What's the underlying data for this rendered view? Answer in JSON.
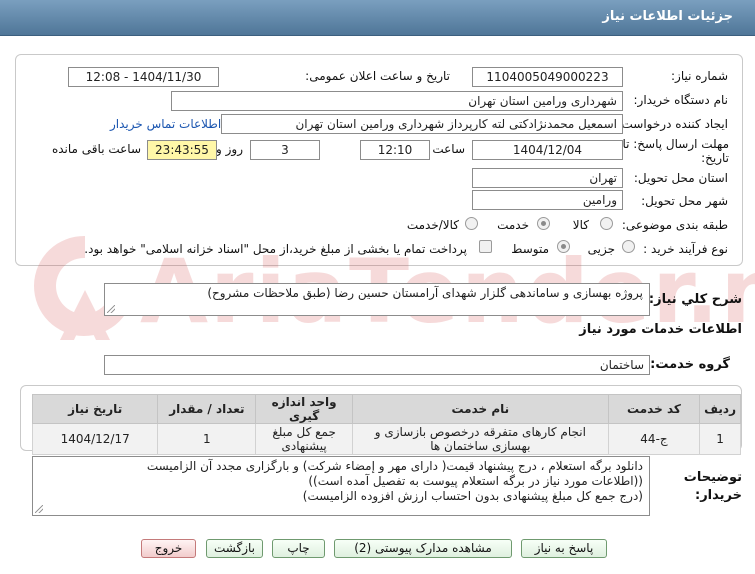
{
  "header": {
    "title": "جزئیات اطلاعات نیاز"
  },
  "details": {
    "need_number_label": "شماره نیاز:",
    "need_number": "1104005049000223",
    "announce_label": "تاریخ و ساعت اعلان عمومی:",
    "announce_value": "1404/11/30 - 12:08",
    "buyer_org_label": "نام دستگاه خریدار:",
    "buyer_org": "شهرداری ورامین استان تهران",
    "requester_label": "ایجاد کننده درخواست:",
    "requester": "اسمعیل محمدنژادکتی لته کارپرداز شهرداری ورامین استان تهران",
    "contact_link": "اطلاعات تماس خریدار",
    "deadline_label": "مهلت ارسال پاسخ: تا تاریخ:",
    "deadline_date": "1404/12/04",
    "time_label": "ساعت",
    "deadline_time": "12:10",
    "days_value": "3",
    "days_label": "روز و",
    "remaining_time": "23:43:55",
    "remaining_label": "ساعت باقی مانده",
    "province_label": "استان محل تحویل:",
    "province": "تهران",
    "city_label": "شهر محل تحویل:",
    "city": "ورامین",
    "category_label": "طبقه بندی موضوعی:",
    "category_options": [
      "کالا",
      "خدمت",
      "کالا/خدمت"
    ],
    "process_label": "نوع فرآیند خرید :",
    "process_options": [
      "جزیی",
      "متوسط"
    ],
    "payment_note": "پرداخت تمام یا بخشی از مبلغ خرید،از محل \"اسناد خزانه اسلامی\" خواهد بود."
  },
  "summary": {
    "label": "شرح کلي نياز:",
    "text": "پروژه بهسازی و ساماندهی گلزار شهدای آرامستان حسین رضا (طبق ملاحظات مشروح)"
  },
  "services": {
    "section_title": "اطلاعات خدمات مورد نیاز",
    "group_label": "گروه خدمت:",
    "group_value": "ساختمان",
    "table": {
      "headers": [
        "ردیف",
        "کد خدمت",
        "نام خدمت",
        "واحد اندازه گیری",
        "تعداد / مقدار",
        "تاریخ نیاز"
      ],
      "rows": [
        [
          "1",
          "ج-44",
          "انجام کارهای متفرقه درخصوص بازسازی و بهسازی ساختمان ها",
          "جمع کل مبلغ پیشنهادی",
          "1",
          "1404/12/17"
        ]
      ]
    }
  },
  "notes": {
    "label": "توضیحات خریدار:",
    "lines": [
      "دانلود برگه استعلام ، درج پیشنهاد قیمت( دارای مهر و إمضاء شرکت) و بارگزاری مجدد آن الزامیست",
      "((اطلاعات مورد نیاز در برگه استعلام پیوست به تفصیل آمده است))",
      "(درج  جمع کل مبلغ پیشنهادی بدون احتساب ارزش افزوده الزامیست)"
    ]
  },
  "buttons": {
    "respond": "پاسخ به نیاز",
    "attachments": "مشاهده مدارک پیوستی (2)",
    "print": "چاپ",
    "back": "بازگشت",
    "exit": "خروج"
  },
  "watermark": {
    "text": "AriaTender.net"
  },
  "colors": {
    "header": "#5b82a6",
    "clock": "#fff7a8",
    "link": "#1a55b0",
    "button_green": "#dff0df",
    "button_red": "#f2cccc"
  }
}
